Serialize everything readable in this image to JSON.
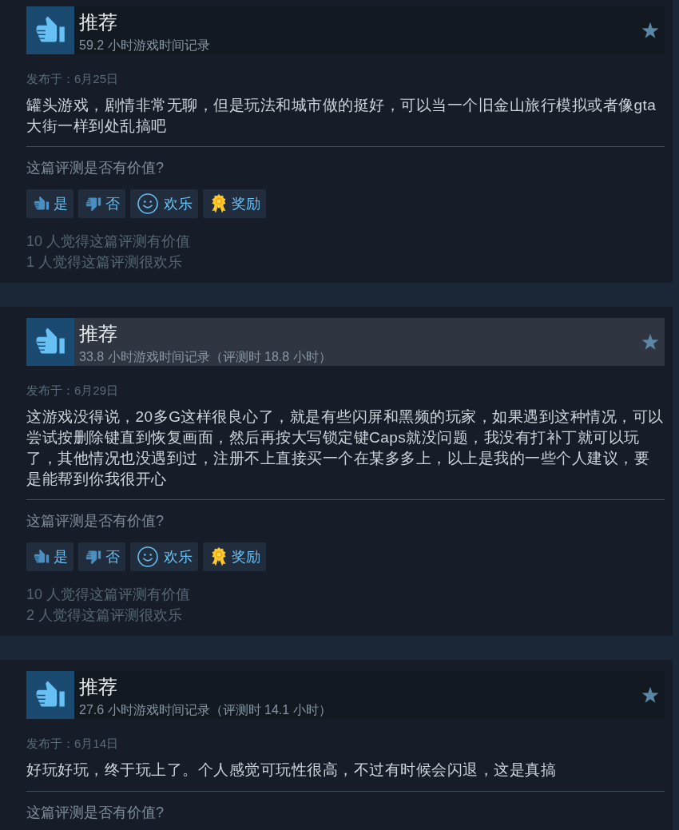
{
  "reviews": [
    {
      "verdict": "推荐",
      "hours": "59.2 小时游戏时间记录",
      "hovered": false,
      "posted": "发布于：6月25日",
      "text": "罐头游戏，剧情非常无聊，但是玩法和城市做的挺好，可以当一个旧金山旅行模拟或者像gta大街一样到处乱搞吧",
      "helpful_prompt": "这篇评测是否有价值?",
      "buttons": [
        {
          "kind": "yes",
          "label": "是"
        },
        {
          "kind": "no",
          "label": "否"
        },
        {
          "kind": "funny",
          "label": "欢乐"
        },
        {
          "kind": "award",
          "label": "奖励"
        }
      ],
      "stats": [
        "10 人觉得这篇评测有价值",
        "1 人觉得这篇评测很欢乐"
      ]
    },
    {
      "verdict": "推荐",
      "hours": "33.8 小时游戏时间记录（评测时 18.8 小时）",
      "hovered": true,
      "posted": "发布于：6月29日",
      "text": "这游戏没得说，20多G这样很良心了，就是有些闪屏和黑频的玩家，如果遇到这种情况，可以尝试按删除键直到恢复画面，然后再按大写锁定键Caps就没问题，我没有打补丁就可以玩了，其他情况也没遇到过，注册不上直接买一个在某多多上，以上是我的一些个人建议，要是能帮到你我很开心",
      "helpful_prompt": "这篇评测是否有价值?",
      "buttons": [
        {
          "kind": "yes",
          "label": "是"
        },
        {
          "kind": "no",
          "label": "否"
        },
        {
          "kind": "funny",
          "label": "欢乐"
        },
        {
          "kind": "award",
          "label": "奖励"
        }
      ],
      "stats": [
        "10 人觉得这篇评测有价值",
        "2 人觉得这篇评测很欢乐"
      ]
    },
    {
      "verdict": "推荐",
      "hours": "27.6 小时游戏时间记录（评测时 14.1 小时）",
      "hovered": false,
      "posted": "发布于：6月14日",
      "text": "好玩好玩，终于玩上了。个人感觉可玩性很高，不过有时候会闪退，这是真搞",
      "helpful_prompt": "这篇评测是否有价值?"
    }
  ]
}
